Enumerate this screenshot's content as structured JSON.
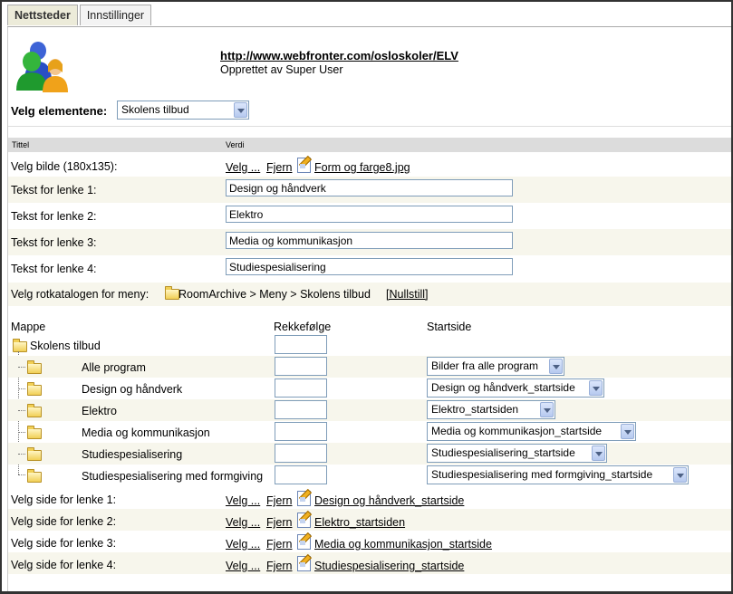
{
  "tabs": {
    "active": "Nettsteder",
    "inactive": "Innstillinger"
  },
  "site": {
    "url": "http://www.webfronter.com/osloskoler/ELV",
    "created_by": "Opprettet av Super User"
  },
  "element_select": {
    "label": "Velg elementene:",
    "value": "Skolens tilbud"
  },
  "table_headers": {
    "title": "Tittel",
    "value": "Verdi"
  },
  "image_row": {
    "label": "Velg bilde (180x135):",
    "choose": "Velg ...",
    "remove": "Fjern",
    "file": "Form og farge8.jpg"
  },
  "link_texts": [
    {
      "label": "Tekst for lenke 1:",
      "value": "Design og håndverk"
    },
    {
      "label": "Tekst for lenke 2:",
      "value": "Elektro"
    },
    {
      "label": "Tekst for lenke 3:",
      "value": "Media og kommunikasjon"
    },
    {
      "label": "Tekst for lenke 4:",
      "value": "Studiespesialisering"
    }
  ],
  "root_catalog": {
    "label": "Velg rotkatalogen for meny:",
    "path": "RoomArchive > Meny > Skolens tilbud",
    "reset": "[Nullstill]"
  },
  "folder_table": {
    "headers": {
      "folder": "Mappe",
      "order": "Rekkefølge",
      "startpage": "Startside"
    },
    "root": "Skolens tilbud",
    "rows": [
      {
        "name": "Alle program",
        "startpage": "Bilder fra alle program"
      },
      {
        "name": "Design og håndverk",
        "startpage": "Design og håndverk_startside"
      },
      {
        "name": "Elektro",
        "startpage": "Elektro_startsiden"
      },
      {
        "name": "Media og kommunikasjon",
        "startpage": "Media og kommunikasjon_startside"
      },
      {
        "name": "Studiespesialisering",
        "startpage": "Studiespesialisering_startside"
      },
      {
        "name": "Studiespesialisering med formgiving",
        "startpage": "Studiespesialisering med formgiving_startside"
      }
    ]
  },
  "link_pages": [
    {
      "label": "Velg side for lenke 1:",
      "choose": "Velg ...",
      "remove": "Fjern",
      "page": "Design og håndverk_startside"
    },
    {
      "label": "Velg side for lenke 2:",
      "choose": "Velg ...",
      "remove": "Fjern",
      "page": "Elektro_startsiden"
    },
    {
      "label": "Velg side for lenke 3:",
      "choose": "Velg ...",
      "remove": "Fjern",
      "page": "Media og kommunikasjon_startside"
    },
    {
      "label": "Velg side for lenke 4:",
      "choose": "Velg ...",
      "remove": "Fjern",
      "page": "Studiespesialisering_startside"
    }
  ]
}
